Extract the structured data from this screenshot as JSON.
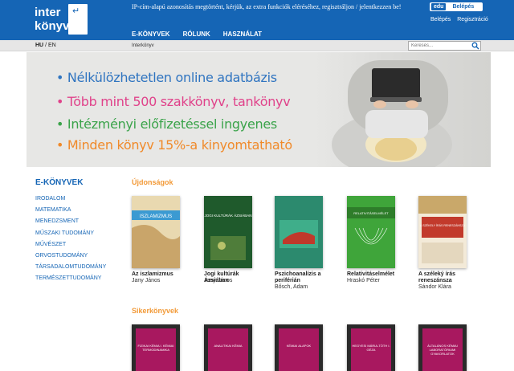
{
  "header": {
    "logo_line1": "inter",
    "logo_line2": "könyv",
    "notice": "IP-cím-alapú azonosítás megtörtént, kérjük, az extra funkciók eléréséhez, regisztráljon / jelentkezzen be!",
    "edu_badge": "edu",
    "edu_login": "Belépés",
    "login": "Belépés",
    "register": "Regisztráció",
    "nav": [
      "E-KÖNYVEK",
      "RÓLUNK",
      "HASZNÁLAT"
    ]
  },
  "subbar": {
    "lang_hu": "HU",
    "lang_sep": " / ",
    "lang_en": "EN",
    "breadcrumb": "Interkönyv",
    "search_placeholder": "Keresés..."
  },
  "banner": {
    "lines": [
      {
        "text": "• Nélkülözhetetlen online adatbázis",
        "color": "#2f74c0"
      },
      {
        "text": "• Több mint 500 szakkönyv, tankönyv",
        "color": "#e0428a"
      },
      {
        "text": "• Intézményi előfizetéssel ingyenes",
        "color": "#3aa34a"
      },
      {
        "text": "• Minden könyv 15%-a kinyomtatható",
        "color": "#f08a2a"
      }
    ]
  },
  "sidebar": {
    "title": "E-KÖNYVEK",
    "items": [
      "IRODALOM",
      "MATEMATIKA",
      "MENEDZSMENT",
      "MŰSZAKI TUDOMÁNY",
      "MŰVÉSZET",
      "ORVOSTUDOMÁNY",
      "TÁRSADALOMTUDOMÁNY",
      "TERMÉSZETTUDOMÁNY"
    ]
  },
  "new_books": {
    "title": "Újdonságok",
    "books": [
      {
        "title": "Az iszlamizmus",
        "author": "Jany János",
        "cover": "#e9d9b0",
        "band": "#3b9ad2",
        "cover_text": "ISZLAMIZMUS"
      },
      {
        "title": "Jogi kultúrák Ázsiában",
        "author": "Jany János",
        "cover": "#1f5a2c",
        "band": "#1f5a2c",
        "cover_text": "JOGI KULTÚRÁK ÁZSIÁBAN"
      },
      {
        "title": "Pszichoanalízis a periférián",
        "author": "Bősch, Adam",
        "cover": "#2c8a6e",
        "band": "#2c8a6e",
        "cover_text": ""
      },
      {
        "title": "Relativitáselmélet",
        "author": "Hraskó Péter",
        "cover": "#3fa53a",
        "band": "#3fa53a",
        "cover_text": "RELATIVITÁSELMÉLET"
      },
      {
        "title": "A széleký írás reneszánsza",
        "author": "Sándor Klára",
        "cover": "#f3ead8",
        "band": "#c23a2c",
        "cover_text": "A SZÉKELY ÍRÁS RENESZÁNSZA"
      }
    ]
  },
  "bestsellers": {
    "title": "Sikerkönyvek",
    "books": [
      {
        "cover_text": "FIZIKAI KÉMIA I. KÉMIAI TERMODINAMIKA"
      },
      {
        "cover_text": "ANALITIKAI KÉMIA"
      },
      {
        "cover_text": "KÉMIAI ALAPOK"
      },
      {
        "cover_text": "HEGYESI MÁRIA-TÓTH I. GÉZA"
      },
      {
        "cover_text": "ÁLTALÁNOS KÉMIAI LABORATÓRIUMI GYAKORLATOK"
      }
    ]
  }
}
